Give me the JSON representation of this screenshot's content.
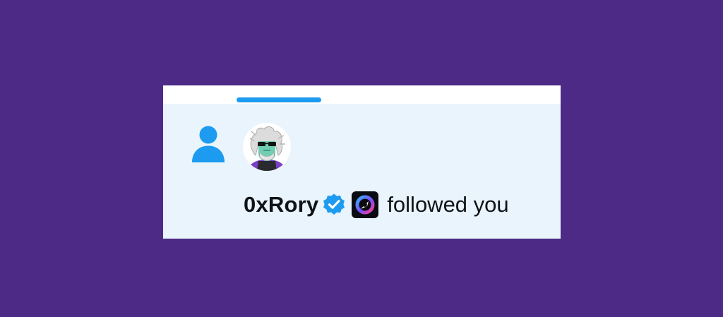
{
  "notification": {
    "user_name": "0xRory",
    "action_text": "followed you",
    "type_icon": "person-icon",
    "verified_icon": "verified-badge-icon",
    "affiliate_icon": "affiliate-logo-icon"
  },
  "colors": {
    "background": "#4d2a86",
    "card": "#e9f4fc",
    "accent": "#1d9bf0",
    "text": "#0f1419"
  }
}
